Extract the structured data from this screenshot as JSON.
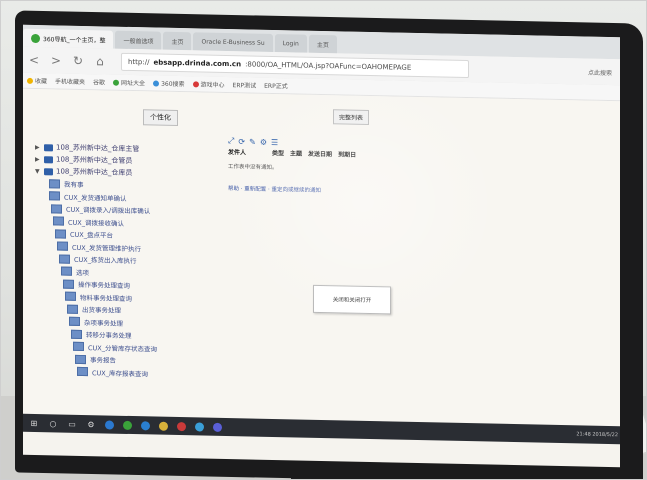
{
  "browser": {
    "tabs": [
      {
        "label": "360导航_一个主页，整",
        "active": true
      },
      {
        "label": "一般首选项",
        "active": false
      },
      {
        "label": "主页",
        "active": false
      },
      {
        "label": "Oracle E-Business Su",
        "active": false
      },
      {
        "label": "Login",
        "active": false
      },
      {
        "label": "主页",
        "active": false
      }
    ],
    "nav": {
      "back": "<",
      "forward": ">",
      "refresh": "↻",
      "home": "⌂"
    },
    "url_prefix": "http://",
    "url_domain": "ebsapp.drinda.com.cn",
    "url_rest": ":8000/OA_HTML/OA.jsp?OAFunc=OAHOMEPAGE",
    "right_text": "点此搜索"
  },
  "favorites": {
    "items": [
      "收藏",
      "手机收藏夹",
      "谷歌",
      "网址大全",
      "360搜索",
      "游戏中心",
      "ERP测试",
      "ERP正式"
    ]
  },
  "page": {
    "personalize_button": "个性化",
    "manage_list_button": "完整列表",
    "tree_nodes": [
      "108_苏州新中达_仓库主管",
      "108_苏州新中达_仓管员",
      "108_苏州新中达_仓库员"
    ],
    "tree_leaves": [
      "我有事",
      "CUX_发货通知单确认",
      "CUX_调拨录入/调拨出库确认",
      "CUX_调拨接收确认",
      "CUX_盘点平台",
      "CUX_发货管理维护执行",
      "CUX_拣货出入库执行",
      "选项",
      "操作事务处理查询",
      "物料事务处理查询",
      "出货事务处理",
      "杂项事务处理",
      "转移分事务处理",
      "CUX_分管库存状态查询",
      "事务报告",
      "CUX_库存报表查询"
    ],
    "worklist": {
      "columns": [
        "发件人",
        "类型",
        "主题",
        "发送日期",
        "到期日"
      ],
      "empty_text": "工作表中没有通知。",
      "links_text": "帮助 · 重新配置 · 重定向或继续的通知"
    },
    "dialog_text": "关闭和关闭打开"
  },
  "taskbar": {
    "items": [
      "start",
      "search",
      "task-view",
      "edge",
      "browser360",
      "ie",
      "folder",
      "store",
      "app1",
      "app2",
      "app3"
    ],
    "tray_text": "21:48 2018/5/22"
  }
}
